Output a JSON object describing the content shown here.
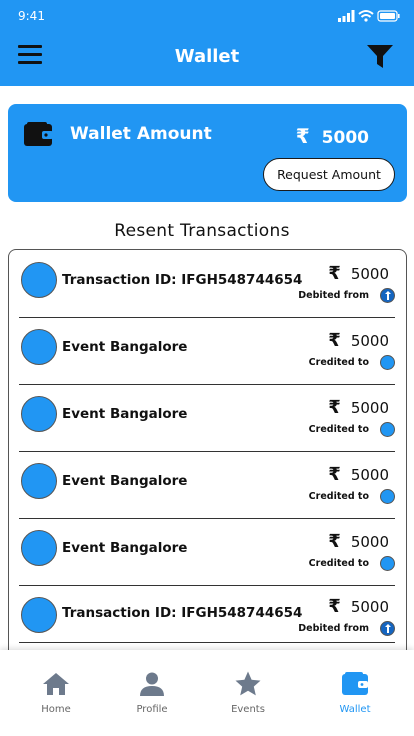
{
  "status_bar": {
    "time": "9:41"
  },
  "app_bar": {
    "title": "Wallet",
    "menu_icon": "menu-icon",
    "filter_icon": "filter-icon"
  },
  "wallet": {
    "label": "Wallet Amount",
    "currency_symbol": "₹",
    "amount": "5000",
    "request_button": "Request Amount",
    "icon": "wallet-icon"
  },
  "transactions": {
    "title": "Resent Transactions",
    "items": [
      {
        "title": "Transaction ID: IFGH548744654",
        "currency_symbol": "₹",
        "amount": "5000",
        "status": "Debited from",
        "type": "debit"
      },
      {
        "title": "Event Bangalore",
        "currency_symbol": "₹",
        "amount": "5000",
        "status": "Credited to",
        "type": "credit"
      },
      {
        "title": "Event Bangalore",
        "currency_symbol": "₹",
        "amount": "5000",
        "status": "Credited to",
        "type": "credit"
      },
      {
        "title": "Event Bangalore",
        "currency_symbol": "₹",
        "amount": "5000",
        "status": "Credited to",
        "type": "credit"
      },
      {
        "title": "Event Bangalore",
        "currency_symbol": "₹",
        "amount": "5000",
        "status": "Credited to",
        "type": "credit"
      },
      {
        "title": "Transaction ID: IFGH548744654",
        "currency_symbol": "₹",
        "amount": "5000",
        "status": "Debited from",
        "type": "debit"
      }
    ]
  },
  "bottom_nav": {
    "items": [
      {
        "label": "Home",
        "icon": "home-icon"
      },
      {
        "label": "Profile",
        "icon": "profile-icon"
      },
      {
        "label": "Events",
        "icon": "star-icon"
      },
      {
        "label": "Wallet",
        "icon": "wallet-icon",
        "active": true
      }
    ]
  },
  "colors": {
    "primary": "#2196f3",
    "inactive_icon": "#6d7a8c",
    "text": "#111111"
  }
}
